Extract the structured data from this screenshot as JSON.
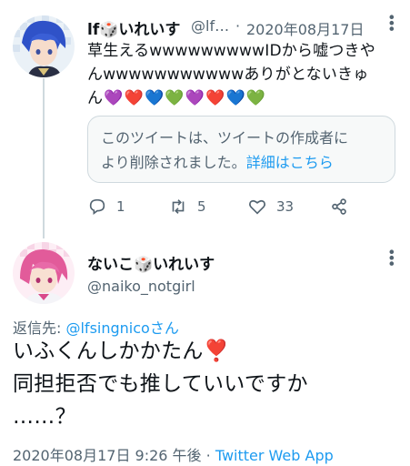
{
  "tweet1": {
    "display_name": "lf🎲いれいす",
    "handle": "@lf…",
    "separator": "·",
    "date": "2020年08月17日",
    "text_line1": "草生えるwwwwwwwwwIDから嘘つきや",
    "text_line2": "んwwwwwwwwwwwありがとないきゅ",
    "text_line3_prefix": "ん",
    "hearts": [
      "💜",
      "❤️",
      "💙",
      "💚",
      "💜",
      "❤️",
      "💙",
      "💚"
    ],
    "deleted_notice_line1": "このツイートは、ツイートの作成者に",
    "deleted_notice_line2": "より削除されました。",
    "deleted_notice_link": "詳細はこちら",
    "reply_count": "1",
    "retweet_count": "5",
    "like_count": "33",
    "more_icon": "more-dots-icon"
  },
  "tweet2": {
    "display_name": "ないこ🎲いれいす",
    "handle": "@naiko_notgirl",
    "reply_to_label": "返信先: ",
    "reply_to_handle": "@lfsingnicoさん",
    "text_line1": "いふくんしかかたん❣️",
    "text_line2": "同担拒否でも推していいですか",
    "text_line3": "……？",
    "timestamp": "2020年08月17日 9:26 午後",
    "separator": " · ",
    "source": "Twitter Web App"
  },
  "colors": {
    "link": "#1d9bf0",
    "muted": "#536471",
    "text": "#0f1419",
    "border": "#cfd9de"
  }
}
